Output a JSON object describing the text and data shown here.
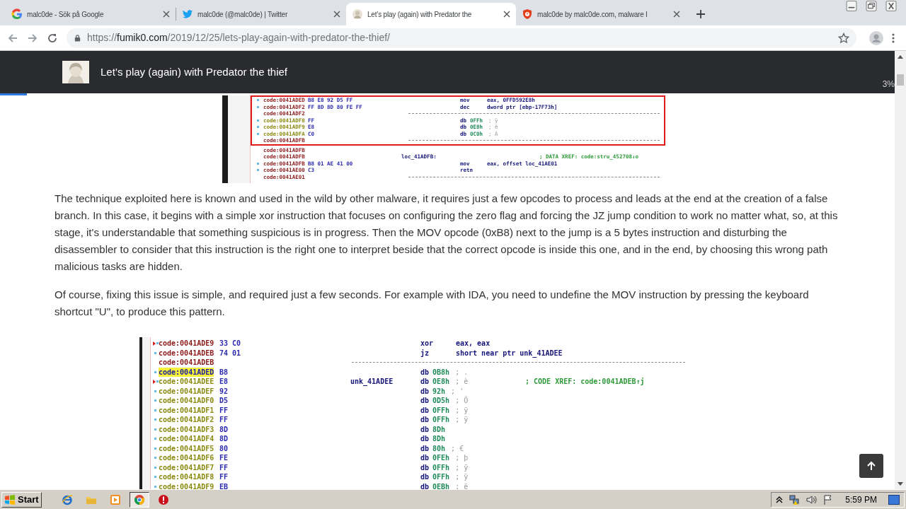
{
  "browser": {
    "tabs": [
      {
        "title": "malc0de - Sök på Google",
        "selected": false
      },
      {
        "title": "malc0de (@malc0de) | Twitter",
        "selected": false
      },
      {
        "title": "Let’s play (again) with Predator the",
        "selected": true
      },
      {
        "title": "malc0de by malc0de.com, malware I",
        "selected": false
      }
    ],
    "url": {
      "scheme": "https://",
      "host": "fumik0.com",
      "path": "/2019/12/25/lets-play-again-with-predator-the-thief/"
    }
  },
  "page_header": {
    "title": "Let’s play (again) with Predator the thief"
  },
  "reading_progress": {
    "level": 0.03,
    "label": "3%"
  },
  "article": [
    {
      "kind": "listing",
      "blocks": [
        {
          "highlighted": true,
          "rows": [
            {
              "kind": "code",
              "marked": true,
              "jump_target": false,
              "selected": false,
              "addr": "code:0041ADED",
              "bytes": "B8 E8 92 D5 FF",
              "mnemonic": "mov",
              "operand": "eax, 0FFD592E8h"
            },
            {
              "kind": "code",
              "marked": true,
              "jump_target": false,
              "selected": false,
              "addr": "code:0041ADF2",
              "bytes": "FF 8D 8D 80 FE FF",
              "mnemonic": "dec",
              "operand": "dword ptr [ebp-17F73h]"
            },
            {
              "kind": "separator",
              "marked": false,
              "jump_target": false,
              "selected": false,
              "addr": "code:0041ADF2"
            },
            {
              "kind": "data",
              "marked": true,
              "jump_target": false,
              "selected": false,
              "addr": "code:0041ADF8",
              "bytes": "FF",
              "mnemonic": "db",
              "operand": "0FFh",
              "note": "; ÿ"
            },
            {
              "kind": "data",
              "marked": true,
              "jump_target": false,
              "selected": false,
              "addr": "code:0041ADF9",
              "bytes": "E8",
              "mnemonic": "db",
              "operand": "0E8h",
              "note": "; è"
            },
            {
              "kind": "data",
              "marked": true,
              "jump_target": false,
              "selected": false,
              "addr": "code:0041ADFA",
              "bytes": "C0",
              "mnemonic": "db",
              "operand": "0C0h",
              "note": "; À"
            },
            {
              "kind": "separator",
              "marked": false,
              "jump_target": false,
              "selected": false,
              "addr": "code:0041ADFB"
            }
          ]
        },
        {
          "highlighted": false,
          "rows": [
            {
              "kind": "code",
              "marked": false,
              "jump_target": false,
              "selected": false,
              "addr": "code:0041ADFB"
            },
            {
              "kind": "code",
              "marked": false,
              "jump_target": false,
              "selected": false,
              "addr": "code:0041ADFB",
              "label": "loc_41ADFB:",
              "comment": "; DATA XREF: code:stru_452708↓o"
            },
            {
              "kind": "code",
              "marked": true,
              "jump_target": false,
              "selected": false,
              "addr": "code:0041ADFB",
              "bytes": "B8 01 AE 41 00",
              "mnemonic": "mov",
              "operand": "eax, offset loc_41AE01"
            },
            {
              "kind": "code",
              "marked": true,
              "jump_target": false,
              "selected": false,
              "addr": "code:0041AE00",
              "bytes": "C3",
              "mnemonic": "retn"
            },
            {
              "kind": "separator",
              "marked": false,
              "jump_target": false,
              "selected": false,
              "addr": "code:0041AE01"
            }
          ]
        }
      ]
    },
    {
      "kind": "paragraph",
      "text": "The technique exploited here is known and used in the wild by other malware, it requires just a few opcodes to process and leads at the end at the creation of a false branch. In this case, it begins with a simple xor instruction that focuses on configuring the zero flag and forcing the JZ jump condition to work no matter what, so, at this stage, it's understandable that something suspicious is in progress. Then the MOV opcode (0xB8) next to the jump is a 5 bytes instruction and disturbing the disassembler to consider that this instruction is the right one to interpret beside that the correct opcode is inside this one, and in the end, by choosing this wrong path malicious tasks are hidden."
    },
    {
      "kind": "paragraph",
      "text": "Of course, fixing this issue is simple, and required just a few seconds. For example with IDA, you need to undefine the MOV instruction by pressing the keyboard shortcut \"U\", to produce this pattern."
    },
    {
      "kind": "listing",
      "blocks": [
        {
          "highlighted": false,
          "rows": [
            {
              "kind": "code",
              "marked": true,
              "jump_target": true,
              "selected": false,
              "addr": "code:0041ADE9",
              "bytes": "33 C0",
              "mnemonic": "xor",
              "operand": "eax, eax"
            },
            {
              "kind": "code",
              "marked": true,
              "jump_target": false,
              "selected": false,
              "addr": "code:0041ADEB",
              "bytes": "74 01",
              "mnemonic": "jz",
              "operand": "short near ptr unk_41ADEE"
            },
            {
              "kind": "separator",
              "marked": false,
              "jump_target": false,
              "selected": false,
              "addr": "code:0041ADEB"
            },
            {
              "kind": "data",
              "marked": true,
              "jump_target": false,
              "selected": true,
              "addr": "code:0041ADED",
              "bytes": "B8",
              "mnemonic": "db",
              "operand": "0B8h",
              "note": "; ."
            },
            {
              "kind": "data",
              "marked": true,
              "jump_target": true,
              "selected": false,
              "addr": "code:0041ADEE",
              "bytes": "E8",
              "label": "unk_41ADEE",
              "mnemonic": "db",
              "operand": "0E8h",
              "note": "; è",
              "comment": "; CODE XREF: code:0041ADEB↑j"
            },
            {
              "kind": "data",
              "marked": true,
              "jump_target": false,
              "selected": false,
              "addr": "code:0041ADEF",
              "bytes": "92",
              "mnemonic": "db",
              "operand": "92h",
              "note": "; '"
            },
            {
              "kind": "data",
              "marked": true,
              "jump_target": false,
              "selected": false,
              "addr": "code:0041ADF0",
              "bytes": "D5",
              "mnemonic": "db",
              "operand": "0D5h",
              "note": "; Õ"
            },
            {
              "kind": "data",
              "marked": true,
              "jump_target": false,
              "selected": false,
              "addr": "code:0041ADF1",
              "bytes": "FF",
              "mnemonic": "db",
              "operand": "0FFh",
              "note": "; ÿ"
            },
            {
              "kind": "data",
              "marked": true,
              "jump_target": false,
              "selected": false,
              "addr": "code:0041ADF2",
              "bytes": "FF",
              "mnemonic": "db",
              "operand": "0FFh",
              "note": "; ÿ"
            },
            {
              "kind": "data",
              "marked": true,
              "jump_target": false,
              "selected": false,
              "addr": "code:0041ADF3",
              "bytes": "8D",
              "mnemonic": "db",
              "operand": "8Dh"
            },
            {
              "kind": "data",
              "marked": true,
              "jump_target": false,
              "selected": false,
              "addr": "code:0041ADF4",
              "bytes": "8D",
              "mnemonic": "db",
              "operand": "8Dh"
            },
            {
              "kind": "data",
              "marked": true,
              "jump_target": false,
              "selected": false,
              "addr": "code:0041ADF5",
              "bytes": "80",
              "mnemonic": "db",
              "operand": "80h",
              "note": "; €"
            },
            {
              "kind": "data",
              "marked": true,
              "jump_target": false,
              "selected": false,
              "addr": "code:0041ADF6",
              "bytes": "FE",
              "mnemonic": "db",
              "operand": "0FEh",
              "note": "; þ"
            },
            {
              "kind": "data",
              "marked": true,
              "jump_target": false,
              "selected": false,
              "addr": "code:0041ADF7",
              "bytes": "FF",
              "mnemonic": "db",
              "operand": "0FFh",
              "note": "; ÿ"
            },
            {
              "kind": "data",
              "marked": true,
              "jump_target": false,
              "selected": false,
              "addr": "code:0041ADF8",
              "bytes": "FF",
              "mnemonic": "db",
              "operand": "0FFh",
              "note": "; ÿ"
            },
            {
              "kind": "data",
              "marked": true,
              "jump_target": false,
              "selected": false,
              "addr": "code:0041ADF9",
              "bytes": "EB",
              "mnemonic": "db",
              "operand": "0EBh",
              "note": "; ë"
            }
          ]
        }
      ]
    }
  ],
  "taskbar": {
    "start": "Start",
    "apps": [
      {
        "selected": false
      },
      {
        "selected": false
      },
      {
        "selected": false
      },
      {
        "selected": true
      },
      {
        "selected": false
      }
    ],
    "clock": "5:59 PM"
  }
}
